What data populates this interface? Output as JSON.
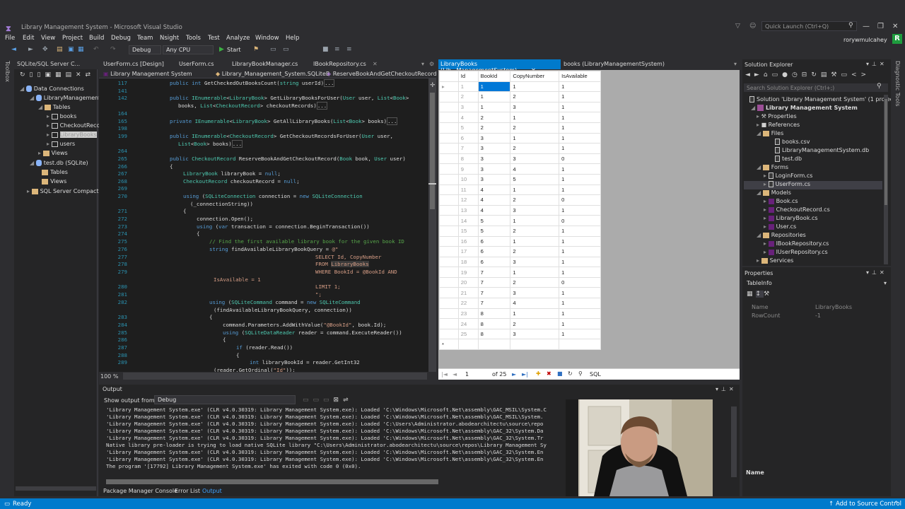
{
  "window": {
    "title": "Library Management System - Microsoft Visual Studio",
    "quick_launch_placeholder": "Quick Launch (Ctrl+Q)",
    "user": "rorywmulcahey",
    "badge": "R"
  },
  "menu": [
    "File",
    "Edit",
    "View",
    "Project",
    "Build",
    "Debug",
    "Team",
    "Nsight",
    "Tools",
    "Test",
    "Analyze",
    "Window",
    "Help"
  ],
  "toolbar": {
    "config": "Debug",
    "platform": "Any CPU",
    "start_label": "Start"
  },
  "left_strip": {
    "toolbox": "Toolbox"
  },
  "sqlite_explorer": {
    "tab_label": "SQLite/SQL Server C...",
    "tree": [
      "Data Connections",
      "LibraryManagementS",
      "Tables",
      "books",
      "CheckoutRecords",
      "LibraryBooks",
      "users",
      "Views",
      "test.db (SQLite)",
      "Tables",
      "Views",
      "SQL Server Compact"
    ]
  },
  "editor": {
    "tabs": [
      "UserForm.cs [Design]",
      "UserForm.cs",
      "LibraryBookManager.cs",
      "IBookRepository.cs"
    ],
    "nav_project": "Library Management System",
    "nav_class": "Library_Management_System.SQLiteB",
    "nav_member": "ReserveBookAndGetCheckoutRecord(",
    "zoom": "100 %",
    "line_numbers": [
      "117",
      "141",
      "142",
      "",
      "164",
      "165",
      "198",
      "199",
      "",
      "264",
      "265",
      "266",
      "267",
      "268",
      "269",
      "270",
      "",
      "271",
      "272",
      "273",
      "274",
      "275",
      "276",
      "277",
      "278",
      "279",
      "",
      "280",
      "281",
      "282",
      "",
      "283",
      "284",
      "285",
      "286",
      "287",
      "288",
      "289"
    ]
  },
  "data_grid": {
    "tab_active": "LibraryBooks (Lib...ManagementSystem)",
    "tab_other": "books (LibraryManagementSystem)",
    "columns": [
      "Id",
      "BookId",
      "CopyNumber",
      "IsAvailable"
    ],
    "rows": [
      [
        "1",
        "1",
        "1",
        "1"
      ],
      [
        "2",
        "1",
        "2",
        "1"
      ],
      [
        "3",
        "1",
        "3",
        "1"
      ],
      [
        "4",
        "2",
        "1",
        "1"
      ],
      [
        "5",
        "2",
        "2",
        "1"
      ],
      [
        "6",
        "3",
        "1",
        "1"
      ],
      [
        "7",
        "3",
        "2",
        "1"
      ],
      [
        "8",
        "3",
        "3",
        "0"
      ],
      [
        "9",
        "3",
        "4",
        "1"
      ],
      [
        "10",
        "3",
        "5",
        "1"
      ],
      [
        "11",
        "4",
        "1",
        "1"
      ],
      [
        "12",
        "4",
        "2",
        "0"
      ],
      [
        "13",
        "4",
        "3",
        "1"
      ],
      [
        "14",
        "5",
        "1",
        "0"
      ],
      [
        "15",
        "5",
        "2",
        "1"
      ],
      [
        "16",
        "6",
        "1",
        "1"
      ],
      [
        "17",
        "6",
        "2",
        "1"
      ],
      [
        "18",
        "6",
        "3",
        "1"
      ],
      [
        "19",
        "7",
        "1",
        "1"
      ],
      [
        "20",
        "7",
        "2",
        "0"
      ],
      [
        "21",
        "7",
        "3",
        "1"
      ],
      [
        "22",
        "7",
        "4",
        "1"
      ],
      [
        "23",
        "8",
        "1",
        "1"
      ],
      [
        "24",
        "8",
        "2",
        "1"
      ],
      [
        "25",
        "8",
        "3",
        "1"
      ]
    ],
    "new_row_marker": "*",
    "nav_position": "1",
    "nav_count": "of 25",
    "nav_sql": "SQL"
  },
  "solution_explorer": {
    "title": "Solution Explorer",
    "search_placeholder": "Search Solution Explorer (Ctrl+;)",
    "items": [
      "Solution 'Library Management System' (1 project)",
      "Library Management System",
      "Properties",
      "References",
      "Files",
      "books.csv",
      "LibraryManagementSystem.db",
      "test.db",
      "Forms",
      "LoginForm.cs",
      "UserForm.cs",
      "Models",
      "Book.cs",
      "CheckoutRecord.cs",
      "LibraryBook.cs",
      "User.cs",
      "Repositories",
      "IBookRepository.cs",
      "IUserRepository.cs",
      "Services"
    ]
  },
  "properties": {
    "title": "Properties",
    "object": "TableInfo",
    "rows": [
      {
        "name": "Name",
        "value": "LibraryBooks"
      },
      {
        "name": "RowCount",
        "value": "-1"
      }
    ],
    "footer_label": "Name"
  },
  "output": {
    "title": "Output",
    "show_from_label": "Show output from:",
    "source": "Debug",
    "lines": [
      "'Library Management System.exe' (CLR v4.0.30319: Library Management System.exe): Loaded 'C:\\Windows\\Microsoft.Net\\assembly\\GAC_MSIL\\System.C",
      "'Library Management System.exe' (CLR v4.0.30319: Library Management System.exe): Loaded 'C:\\Windows\\Microsoft.Net\\assembly\\GAC_MSIL\\System.",
      "'Library Management System.exe' (CLR v4.0.30319: Library Management System.exe): Loaded 'C:\\Users\\Administrator.abodearchitectu\\source\\repo",
      "'Library Management System.exe' (CLR v4.0.30319: Library Management System.exe): Loaded 'C:\\Windows\\Microsoft.Net\\assembly\\GAC_32\\System.Da",
      "'Library Management System.exe' (CLR v4.0.30319: Library Management System.exe): Loaded 'C:\\Windows\\Microsoft.Net\\assembly\\GAC_32\\System.Tr",
      "Native library pre-loader is trying to load native SQLite library \"C:\\Users\\Administrator.abodearchitectu\\source\\repos\\Library Management Sy",
      "'Library Management System.exe' (CLR v4.0.30319: Library Management System.exe): Loaded 'C:\\Windows\\Microsoft.Net\\assembly\\GAC_32\\System.En",
      "'Library Management System.exe' (CLR v4.0.30319: Library Management System.exe): Loaded 'C:\\Windows\\Microsoft.Net\\assembly\\GAC_32\\System.En",
      "The program '[17792] Library Management System.exe' has exited with code 0 (0x0)."
    ],
    "tabs": [
      "Package Manager Console",
      "Error List",
      "Output"
    ]
  },
  "status": {
    "left": "Ready",
    "right": "Add to Source Control"
  }
}
